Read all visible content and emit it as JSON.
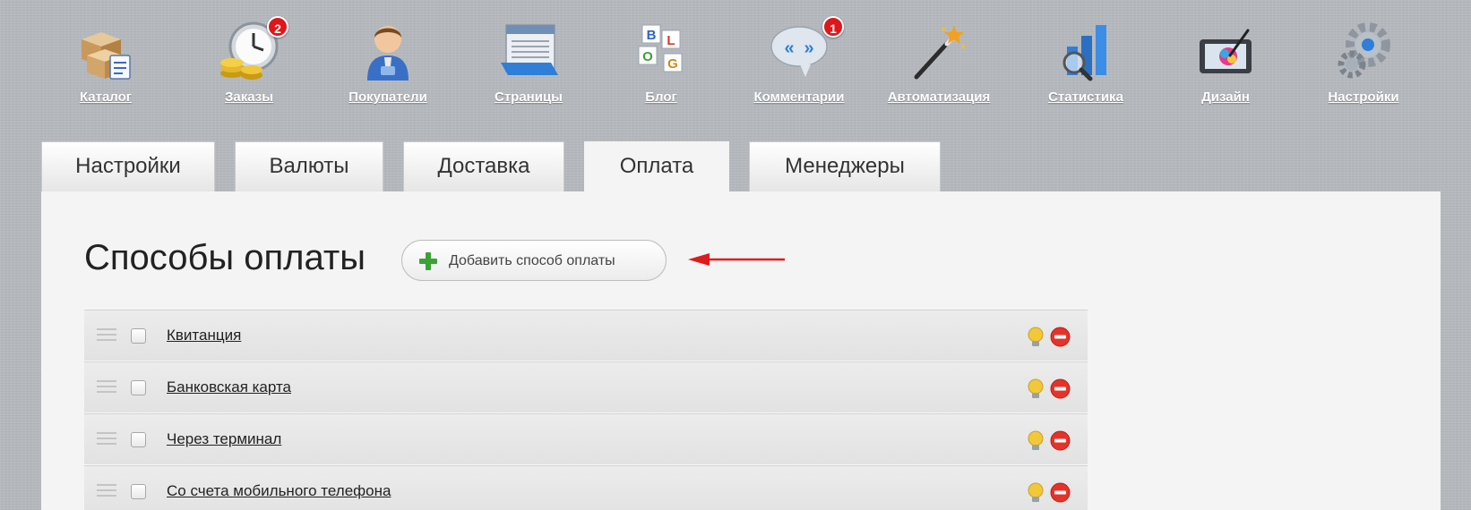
{
  "topmenu": {
    "items": [
      {
        "label": "Каталог",
        "icon": "catalog-boxes-icon"
      },
      {
        "label": "Заказы",
        "icon": "orders-clock-coins-icon",
        "badge": "2"
      },
      {
        "label": "Покупатели",
        "icon": "customers-person-icon"
      },
      {
        "label": "Страницы",
        "icon": "pages-window-icon"
      },
      {
        "label": "Блог",
        "icon": "blog-cubes-icon"
      },
      {
        "label": "Комментарии",
        "icon": "comments-bubble-icon",
        "badge": "1"
      },
      {
        "label": "Автоматизация",
        "icon": "automation-wand-icon"
      },
      {
        "label": "Статистика",
        "icon": "statistics-chart-icon"
      },
      {
        "label": "Дизайн",
        "icon": "design-tablet-icon"
      },
      {
        "label": "Настройки",
        "icon": "settings-gears-icon"
      }
    ]
  },
  "tabs": [
    {
      "label": "Настройки",
      "active": false
    },
    {
      "label": "Валюты",
      "active": false
    },
    {
      "label": "Доставка",
      "active": false
    },
    {
      "label": "Оплата",
      "active": true
    },
    {
      "label": "Менеджеры",
      "active": false
    }
  ],
  "main": {
    "title": "Способы оплаты",
    "add_button_label": "Добавить способ оплаты",
    "payment_methods": [
      {
        "name": "Квитанция"
      },
      {
        "name": "Банковская карта"
      },
      {
        "name": "Через терминал"
      },
      {
        "name": "Со счета мобильного телефона"
      }
    ]
  },
  "colors": {
    "badge": "#e0161b",
    "add_icon": "#3aa335",
    "arrow": "#e01b1b",
    "delete": "#e5332a",
    "bulb": "#f2c838"
  }
}
